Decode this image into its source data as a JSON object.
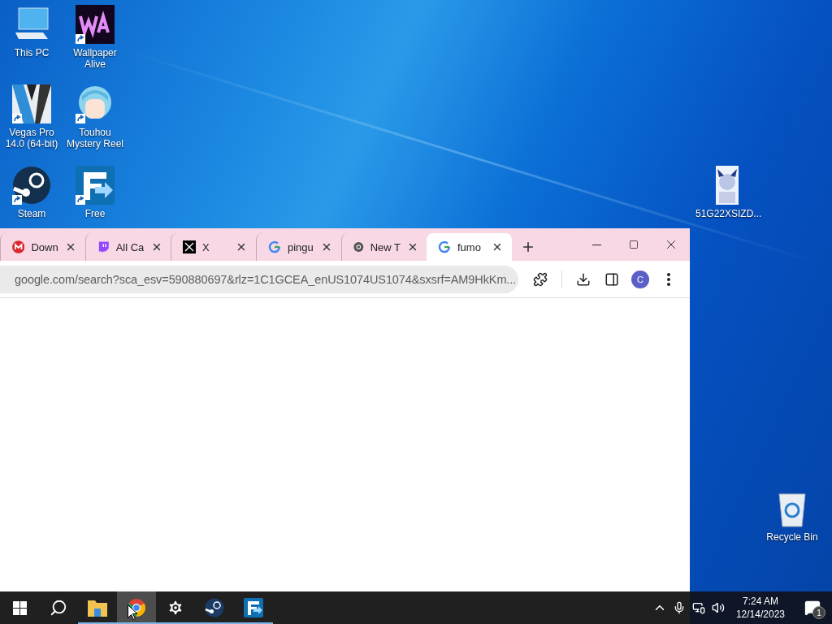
{
  "desktop_icons": [
    {
      "label": "This PC",
      "kind": "pc",
      "shortcut": false
    },
    {
      "label": "Wallpaper Alive",
      "kind": "wa",
      "shortcut": true
    },
    {
      "label": "Vegas Pro 14.0 (64-bit)",
      "kind": "vegas",
      "shortcut": true
    },
    {
      "label": "Touhou Mystery Reel",
      "kind": "touhou",
      "shortcut": true
    },
    {
      "label": "Steam",
      "kind": "steam",
      "shortcut": true
    },
    {
      "label": "Free",
      "kind": "freedl",
      "shortcut": true
    },
    {
      "label": "51G22XSIZD...",
      "kind": "image",
      "shortcut": false
    },
    {
      "label": "Recycle Bin",
      "kind": "bin",
      "shortcut": false
    }
  ],
  "browser": {
    "tabs": [
      {
        "title": "Down",
        "kind": "mega",
        "selected": false
      },
      {
        "title": "All Ca",
        "kind": "twitch",
        "selected": false
      },
      {
        "title": "X",
        "kind": "x",
        "selected": false
      },
      {
        "title": "pingu",
        "kind": "google",
        "selected": false
      },
      {
        "title": "New T",
        "kind": "chrome",
        "selected": false
      },
      {
        "title": "fumo",
        "kind": "google",
        "selected": true
      }
    ],
    "url": "google.com/search?sca_esv=590880697&rlz=1C1GCEA_enUS1074US1074&sxsrf=AM9HkKm...",
    "profile_initial": "C"
  },
  "taskbar": {
    "apps": [
      {
        "kind": "explorer",
        "running": true,
        "active": false
      },
      {
        "kind": "chrome",
        "running": true,
        "active": true
      },
      {
        "kind": "settings",
        "running": true,
        "active": false
      },
      {
        "kind": "steam",
        "running": true,
        "active": false
      },
      {
        "kind": "freedl",
        "running": true,
        "active": false
      }
    ],
    "time": "7:24 AM",
    "date": "12/14/2023",
    "notification_count": "1"
  }
}
